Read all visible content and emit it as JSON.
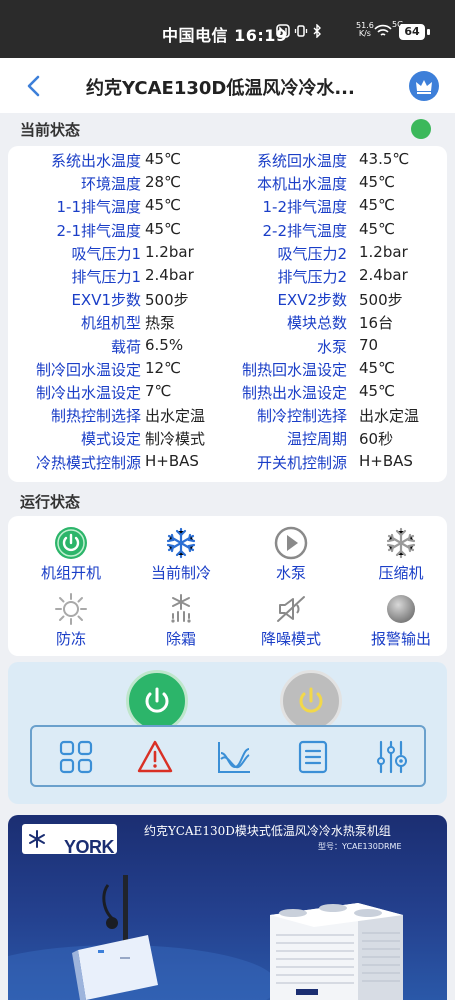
{
  "status_bar": {
    "carrier_time": "中国电信 16:19",
    "net_speed_value": "51.6",
    "net_speed_unit": "K/s",
    "network": "5G",
    "battery": "64"
  },
  "header": {
    "title": "约克YCAE130D低温风冷冷水..."
  },
  "current_status": {
    "section_title": "当前状态",
    "indicator_color": "#3cb85b",
    "rows": [
      {
        "l1": "系统出水温度",
        "v1": "45℃",
        "l2": "系统回水温度",
        "v2": "43.5℃"
      },
      {
        "l1": "环境温度",
        "v1": "28℃",
        "l2": "本机出水温度",
        "v2": "45℃"
      },
      {
        "l1": "1-1排气温度",
        "v1": "45℃",
        "l2": "1-2排气温度",
        "v2": "45℃"
      },
      {
        "l1": "2-1排气温度",
        "v1": "45℃",
        "l2": "2-2排气温度",
        "v2": "45℃"
      },
      {
        "l1": "吸气压力1",
        "v1": "1.2bar",
        "l2": "吸气压力2",
        "v2": "1.2bar"
      },
      {
        "l1": "排气压力1",
        "v1": "2.4bar",
        "l2": "排气压力2",
        "v2": "2.4bar"
      },
      {
        "l1": "EXV1步数",
        "v1": "500步",
        "l2": "EXV2步数",
        "v2": "500步"
      },
      {
        "l1": "机组机型",
        "v1": "热泵",
        "l2": "模块总数",
        "v2": "16台"
      },
      {
        "l1": "载荷",
        "v1": "6.5%",
        "l2": "水泵",
        "v2": "70"
      },
      {
        "l1": "制冷回水温设定",
        "v1": "12℃",
        "l2": "制热回水温设定",
        "v2": "45℃"
      },
      {
        "l1": "制冷出水温设定",
        "v1": "7℃",
        "l2": "制热出水温设定",
        "v2": "45℃"
      },
      {
        "l1": "制热控制选择",
        "v1": "出水定温",
        "l2": "制冷控制选择",
        "v2": "出水定温"
      },
      {
        "l1": "模式设定",
        "v1": "制冷模式",
        "l2": "温控周期",
        "v2": "60秒"
      },
      {
        "l1": "冷热模式控制源",
        "v1": "H+BAS",
        "l2": "开关机控制源",
        "v2": "H+BAS"
      }
    ]
  },
  "run_status": {
    "section_title": "运行状态",
    "items": [
      {
        "label": "机组开机",
        "icon": "power-on-icon",
        "active": true
      },
      {
        "label": "当前制冷",
        "icon": "snowflake-icon",
        "active": true
      },
      {
        "label": "水泵",
        "icon": "pump-play-icon",
        "active": false
      },
      {
        "label": "压缩机",
        "icon": "compressor-snowflake-icon",
        "active": false
      },
      {
        "label": "防冻",
        "icon": "sun-icon",
        "active": false
      },
      {
        "label": "除霜",
        "icon": "defrost-icon",
        "active": false
      },
      {
        "label": "降噪模式",
        "icon": "mute-icon",
        "active": false
      },
      {
        "label": "报警输出",
        "icon": "alarm-dot-icon",
        "active": false
      }
    ]
  },
  "control": {
    "power_on_color": "#2cb56a",
    "power_off_color": "#bdbdbd",
    "tools": [
      "grid-icon",
      "alert-icon",
      "curve-icon",
      "list-icon",
      "settings-sliders-icon"
    ]
  },
  "banner": {
    "brand": "YORK",
    "title": "约克YCAE130D模块式低温风冷冷水热泵机组",
    "model": "型号：YCAE130DRME"
  }
}
